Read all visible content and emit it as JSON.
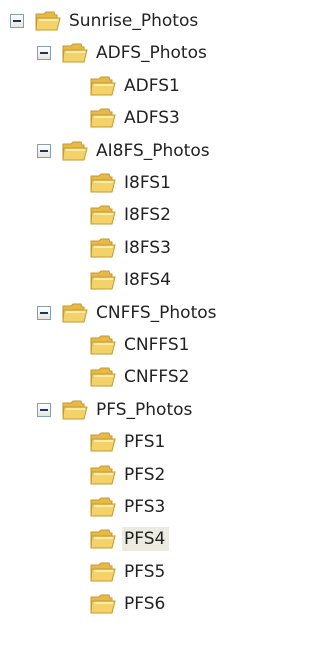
{
  "tree": [
    {
      "label": "Sunrise_Photos",
      "level": 0,
      "expandable": true,
      "selected": false
    },
    {
      "label": "ADFS_Photos",
      "level": 1,
      "expandable": true,
      "selected": false
    },
    {
      "label": "ADFS1",
      "level": 2,
      "expandable": false,
      "selected": false
    },
    {
      "label": "ADFS3",
      "level": 2,
      "expandable": false,
      "selected": false
    },
    {
      "label": "AI8FS_Photos",
      "level": 1,
      "expandable": true,
      "selected": false
    },
    {
      "label": "I8FS1",
      "level": 2,
      "expandable": false,
      "selected": false
    },
    {
      "label": "I8FS2",
      "level": 2,
      "expandable": false,
      "selected": false
    },
    {
      "label": "I8FS3",
      "level": 2,
      "expandable": false,
      "selected": false
    },
    {
      "label": "I8FS4",
      "level": 2,
      "expandable": false,
      "selected": false
    },
    {
      "label": "CNFFS_Photos",
      "level": 1,
      "expandable": true,
      "selected": false
    },
    {
      "label": "CNFFS1",
      "level": 2,
      "expandable": false,
      "selected": false
    },
    {
      "label": "CNFFS2",
      "level": 2,
      "expandable": false,
      "selected": false
    },
    {
      "label": "PFS_Photos",
      "level": 1,
      "expandable": true,
      "selected": false
    },
    {
      "label": "PFS1",
      "level": 2,
      "expandable": false,
      "selected": false
    },
    {
      "label": "PFS2",
      "level": 2,
      "expandable": false,
      "selected": false
    },
    {
      "label": "PFS3",
      "level": 2,
      "expandable": false,
      "selected": false
    },
    {
      "label": "PFS4",
      "level": 2,
      "expandable": false,
      "selected": true
    },
    {
      "label": "PFS5",
      "level": 2,
      "expandable": false,
      "selected": false
    },
    {
      "label": "PFS6",
      "level": 2,
      "expandable": false,
      "selected": false
    }
  ],
  "icons": {
    "toggle": "collapse-icon",
    "folder": "folder-icon"
  },
  "colors": {
    "folder_fill": "#f4d26a",
    "folder_stroke": "#c49a2c",
    "selected_background": "#ecebe2",
    "toggle_border": "#8a9bb6"
  }
}
